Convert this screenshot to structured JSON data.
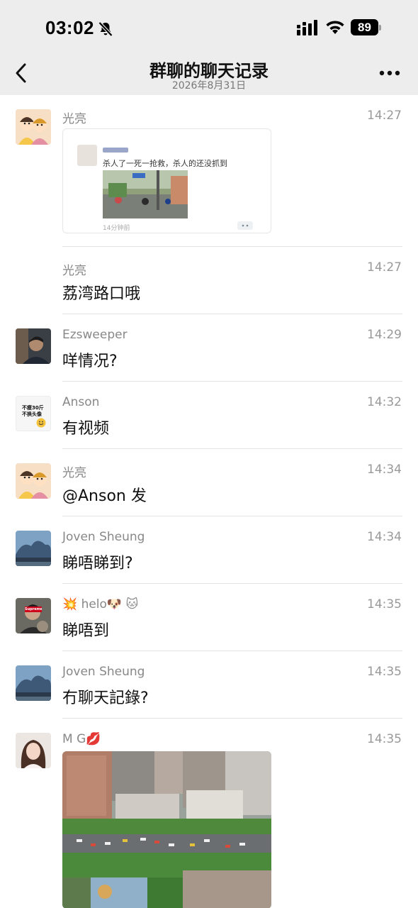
{
  "status_bar": {
    "time": "03:02",
    "battery": "89"
  },
  "header": {
    "title": "群聊的聊天记录",
    "subtitle": "2026年8月31日"
  },
  "messages": [
    {
      "sender": "光亮",
      "time": "14:27",
      "type": "link-card",
      "card": {
        "title": "杀人了一死一抢救，杀人的还没抓到",
        "meta": "14分钟前"
      }
    },
    {
      "sender": "光亮",
      "time": "14:27",
      "text": "荔湾路口哦"
    },
    {
      "sender": "Ezsweeper",
      "time": "14:29",
      "text": "咩情况?"
    },
    {
      "sender": "Anson",
      "time": "14:32",
      "text": "有视频",
      "avatar_text": [
        "不瘦30斤",
        "不换头像"
      ]
    },
    {
      "sender": "光亮",
      "time": "14:34",
      "text": "@Anson 发"
    },
    {
      "sender": "Joven Sheung",
      "time": "14:34",
      "text": "睇唔睇到?"
    },
    {
      "sender": "💥 helo🐶 🐱",
      "time": "14:35",
      "text": "睇唔到",
      "avatar_text": "Supreme"
    },
    {
      "sender": "Joven Sheung",
      "time": "14:35",
      "text": "冇聊天記錄?"
    },
    {
      "sender": "M G💋",
      "time": "14:35",
      "type": "image"
    }
  ],
  "colors": {
    "header_bg": "#ededed",
    "divider": "#e3e3e3",
    "meta_gray": "#888888"
  }
}
